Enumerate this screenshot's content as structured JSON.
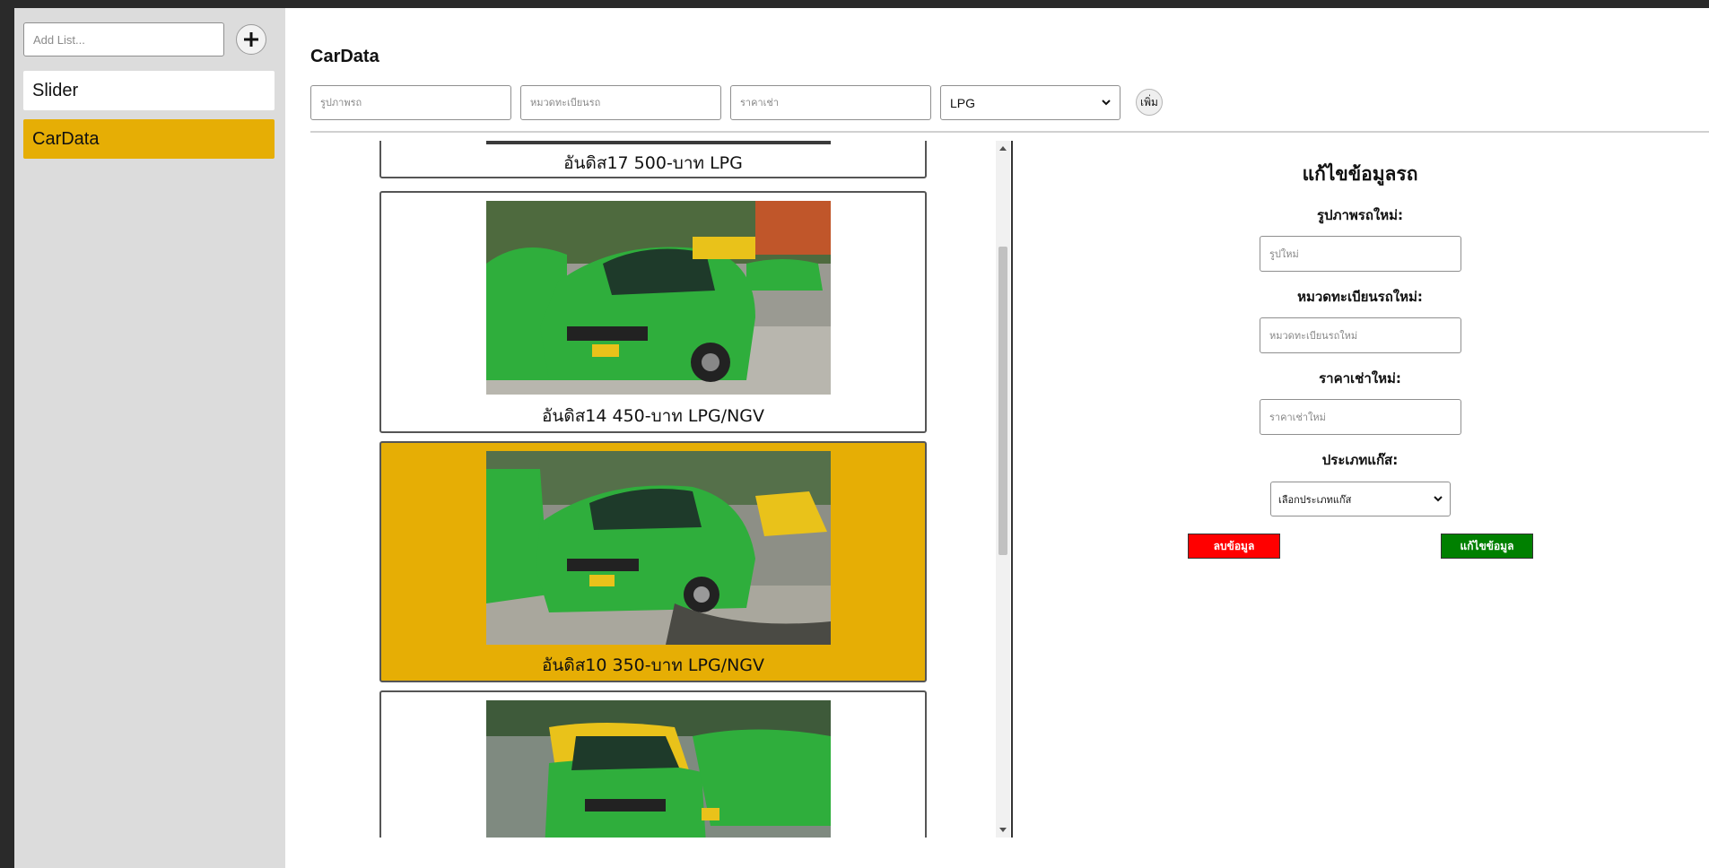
{
  "sidebar": {
    "add_placeholder": "Add List...",
    "add_button_icon": "plus-icon",
    "items": [
      {
        "label": "Slider"
      },
      {
        "label": "CarData"
      }
    ]
  },
  "main": {
    "title": "CarData",
    "form": {
      "image_placeholder": "รูปภาพรถ",
      "plate_placeholder": "หมวดทะเบียนรถ",
      "price_placeholder": "ราคาเช่า",
      "fuel_selected": "LPG",
      "add_label": "เพิ่ม"
    },
    "cars": [
      {
        "caption": "อันดิส17  500-บาท  LPG"
      },
      {
        "caption": "อันดิส14  450-บาท  LPG/NGV"
      },
      {
        "caption": "อันดิส10  350-บาท  LPG/NGV"
      }
    ]
  },
  "edit": {
    "title": "แก้ไขข้อมูลรถ",
    "image_label": "รูปภาพรถใหม่:",
    "image_placeholder": "รูปใหม่",
    "plate_label": "หมวดทะเบียนรถใหม่:",
    "plate_placeholder": "หมวดทะเบียนรถใหม่",
    "price_label": "ราคาเช่าใหม่:",
    "price_placeholder": "ราคาเช่าใหม่",
    "gas_label": "ประเภทแก๊ส:",
    "gas_selected": "เลือกประเภทแก๊ส",
    "delete_label": "ลบข้อมูล",
    "edit_label": "แก้ไขข้อมูล"
  },
  "colors": {
    "accent": "#e6ae05",
    "delete": "#ff0000",
    "edit": "#008000",
    "taxi_green": "#2fae3c",
    "taxi_yellow": "#e9c21a"
  }
}
